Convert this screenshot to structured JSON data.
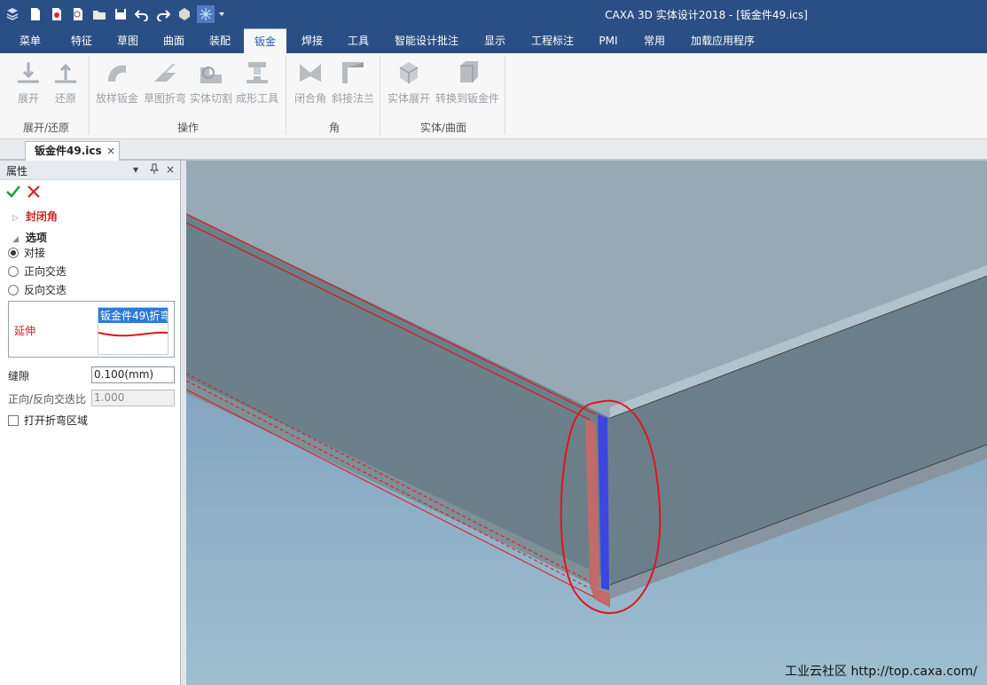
{
  "window": {
    "title": "CAXA 3D 实体设计2018 - [钣金件49.ics]"
  },
  "quick_access": [
    "app-menu-icon",
    "new-icon",
    "open-icon",
    "print-preview-icon",
    "folder-icon",
    "save-icon",
    "undo-icon",
    "redo-icon",
    "render-icon",
    "sparkle-icon",
    "dropdown-icon"
  ],
  "ribbon_tabs": [
    {
      "label": "菜单"
    },
    {
      "label": "特征"
    },
    {
      "label": "草图"
    },
    {
      "label": "曲面"
    },
    {
      "label": "装配"
    },
    {
      "label": "钣金"
    },
    {
      "label": "焊接"
    },
    {
      "label": "工具"
    },
    {
      "label": "智能设计批注"
    },
    {
      "label": "显示"
    },
    {
      "label": "工程标注"
    },
    {
      "label": "PMI"
    },
    {
      "label": "常用"
    },
    {
      "label": "加载应用程序"
    }
  ],
  "ribbon": {
    "groups": [
      {
        "label": "展开/还原"
      },
      {
        "label": "操作"
      },
      {
        "label": "角"
      },
      {
        "label": "实体/曲面"
      }
    ],
    "buttons": [
      {
        "label": "展开",
        "icon": "unfold-icon"
      },
      {
        "label": "还原",
        "icon": "refold-icon"
      },
      {
        "label": "放样钣金",
        "icon": "loft-sheet-icon"
      },
      {
        "label": "草图折弯",
        "icon": "sketch-bend-icon"
      },
      {
        "label": "实体切割",
        "icon": "solid-cut-icon"
      },
      {
        "label": "成形工具",
        "icon": "forming-tool-icon"
      },
      {
        "label": "闭合角",
        "icon": "closed-corner-icon"
      },
      {
        "label": "斜接法兰",
        "icon": "miter-flange-icon"
      },
      {
        "label": "实体展开",
        "icon": "solid-unfold-icon"
      },
      {
        "label": "转换到钣金件",
        "icon": "convert-sheet-icon"
      }
    ]
  },
  "document_tab": {
    "label": "钣金件49.ics",
    "close": "×"
  },
  "properties": {
    "header": "属性",
    "controls": {
      "dropdown": "▾",
      "pin": "ᵰ",
      "close": "×"
    },
    "section_closed_corner": "封闭角",
    "section_options": "选项",
    "radios": [
      {
        "label": "对接",
        "checked": true
      },
      {
        "label": "正向交迭",
        "checked": false
      },
      {
        "label": "反向交迭",
        "checked": false
      }
    ],
    "extend_label": "延伸",
    "extend_selection": "钣金件49\\折弯",
    "gap_label": "缝隙",
    "gap_value": "0.100(mm)",
    "ratio_label": "正向/反向交迭比",
    "ratio_value": "1.000",
    "open_bend_label": "打开折弯区域",
    "open_bend_checked": false
  },
  "watermark": "工业云社区 http://top.caxa.com/",
  "colors": {
    "titlebar": "#2a4f85",
    "highlight_red": "#e0151c",
    "selection_blue": "#2f7ad6"
  }
}
